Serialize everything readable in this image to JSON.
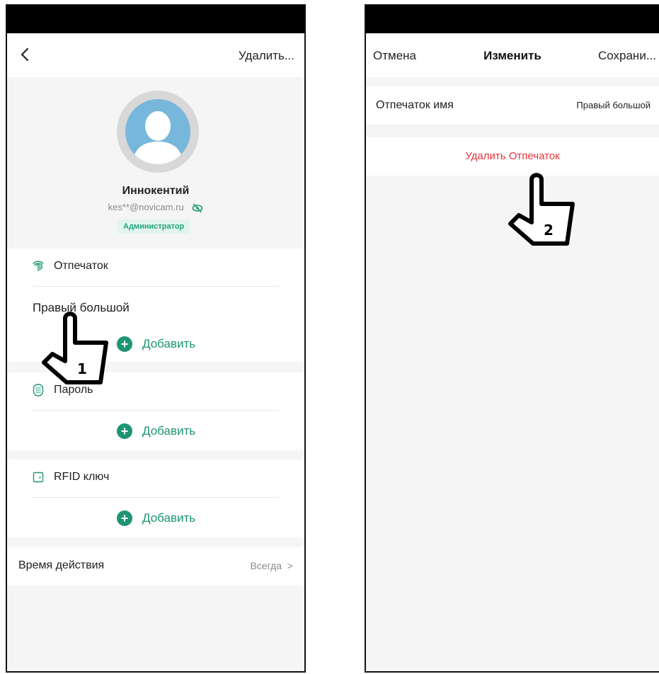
{
  "screen1": {
    "nav": {
      "delete_label": "Удалить..."
    },
    "user": {
      "name": "Иннокентий",
      "email": "kes**@novicam.ru",
      "role": "Администратор"
    },
    "fingerprint": {
      "title": "Отпечаток",
      "items": [
        "Правый большой"
      ],
      "add_label": "Добавить"
    },
    "password": {
      "title": "Пароль",
      "add_label": "Добавить"
    },
    "rfid": {
      "title": "RFID ключ",
      "add_label": "Добавить"
    },
    "validity": {
      "label": "Время действия",
      "value": "Всегда"
    },
    "step_label": "1"
  },
  "screen2": {
    "nav": {
      "cancel_label": "Отмена",
      "title": "Изменить",
      "save_label": "Сохрани..."
    },
    "field": {
      "label": "Отпечаток имя",
      "value": "Правый большой"
    },
    "delete_label": "Удалить Отпечаток",
    "step_label": "2"
  },
  "colors": {
    "accent": "#1d9574",
    "danger": "#e8343a",
    "role_badge_bg": "#e2f4ee",
    "avatar": "#78b7dc"
  },
  "icons": [
    "back-arrow-icon",
    "eye-off-icon",
    "fingerprint-icon",
    "keypad-icon",
    "card-icon",
    "plus-icon",
    "chevron-right-icon",
    "hand-pointer-icon"
  ]
}
